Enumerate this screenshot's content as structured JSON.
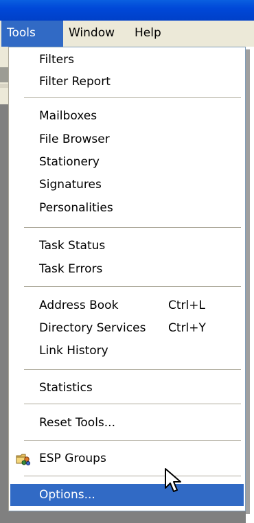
{
  "menubar": {
    "items": [
      {
        "label": "Tools"
      },
      {
        "label": "Window"
      },
      {
        "label": "Help"
      }
    ]
  },
  "tools_menu": {
    "groups": [
      [
        "Filters",
        "Filter Report"
      ],
      [
        "Mailboxes",
        "File Browser",
        "Stationery",
        "Signatures",
        "Personalities"
      ],
      [
        "Task Status",
        "Task Errors"
      ],
      [
        "Address Book",
        "Directory Services",
        "Link History"
      ],
      [
        "Statistics"
      ],
      [
        "Reset Tools..."
      ],
      [
        "ESP Groups"
      ],
      [
        "Options..."
      ]
    ],
    "shortcuts": {
      "address_book": "Ctrl+L",
      "directory_services": "Ctrl+Y"
    },
    "selected": "Options...",
    "icons": {
      "esp_groups": "esp-groups-folder-icon"
    }
  },
  "colors": {
    "highlight": "#316ac5",
    "menu_bg": "#ffffff",
    "menubar_bg": "#ece9d8",
    "titlebar": "#0048d8"
  }
}
